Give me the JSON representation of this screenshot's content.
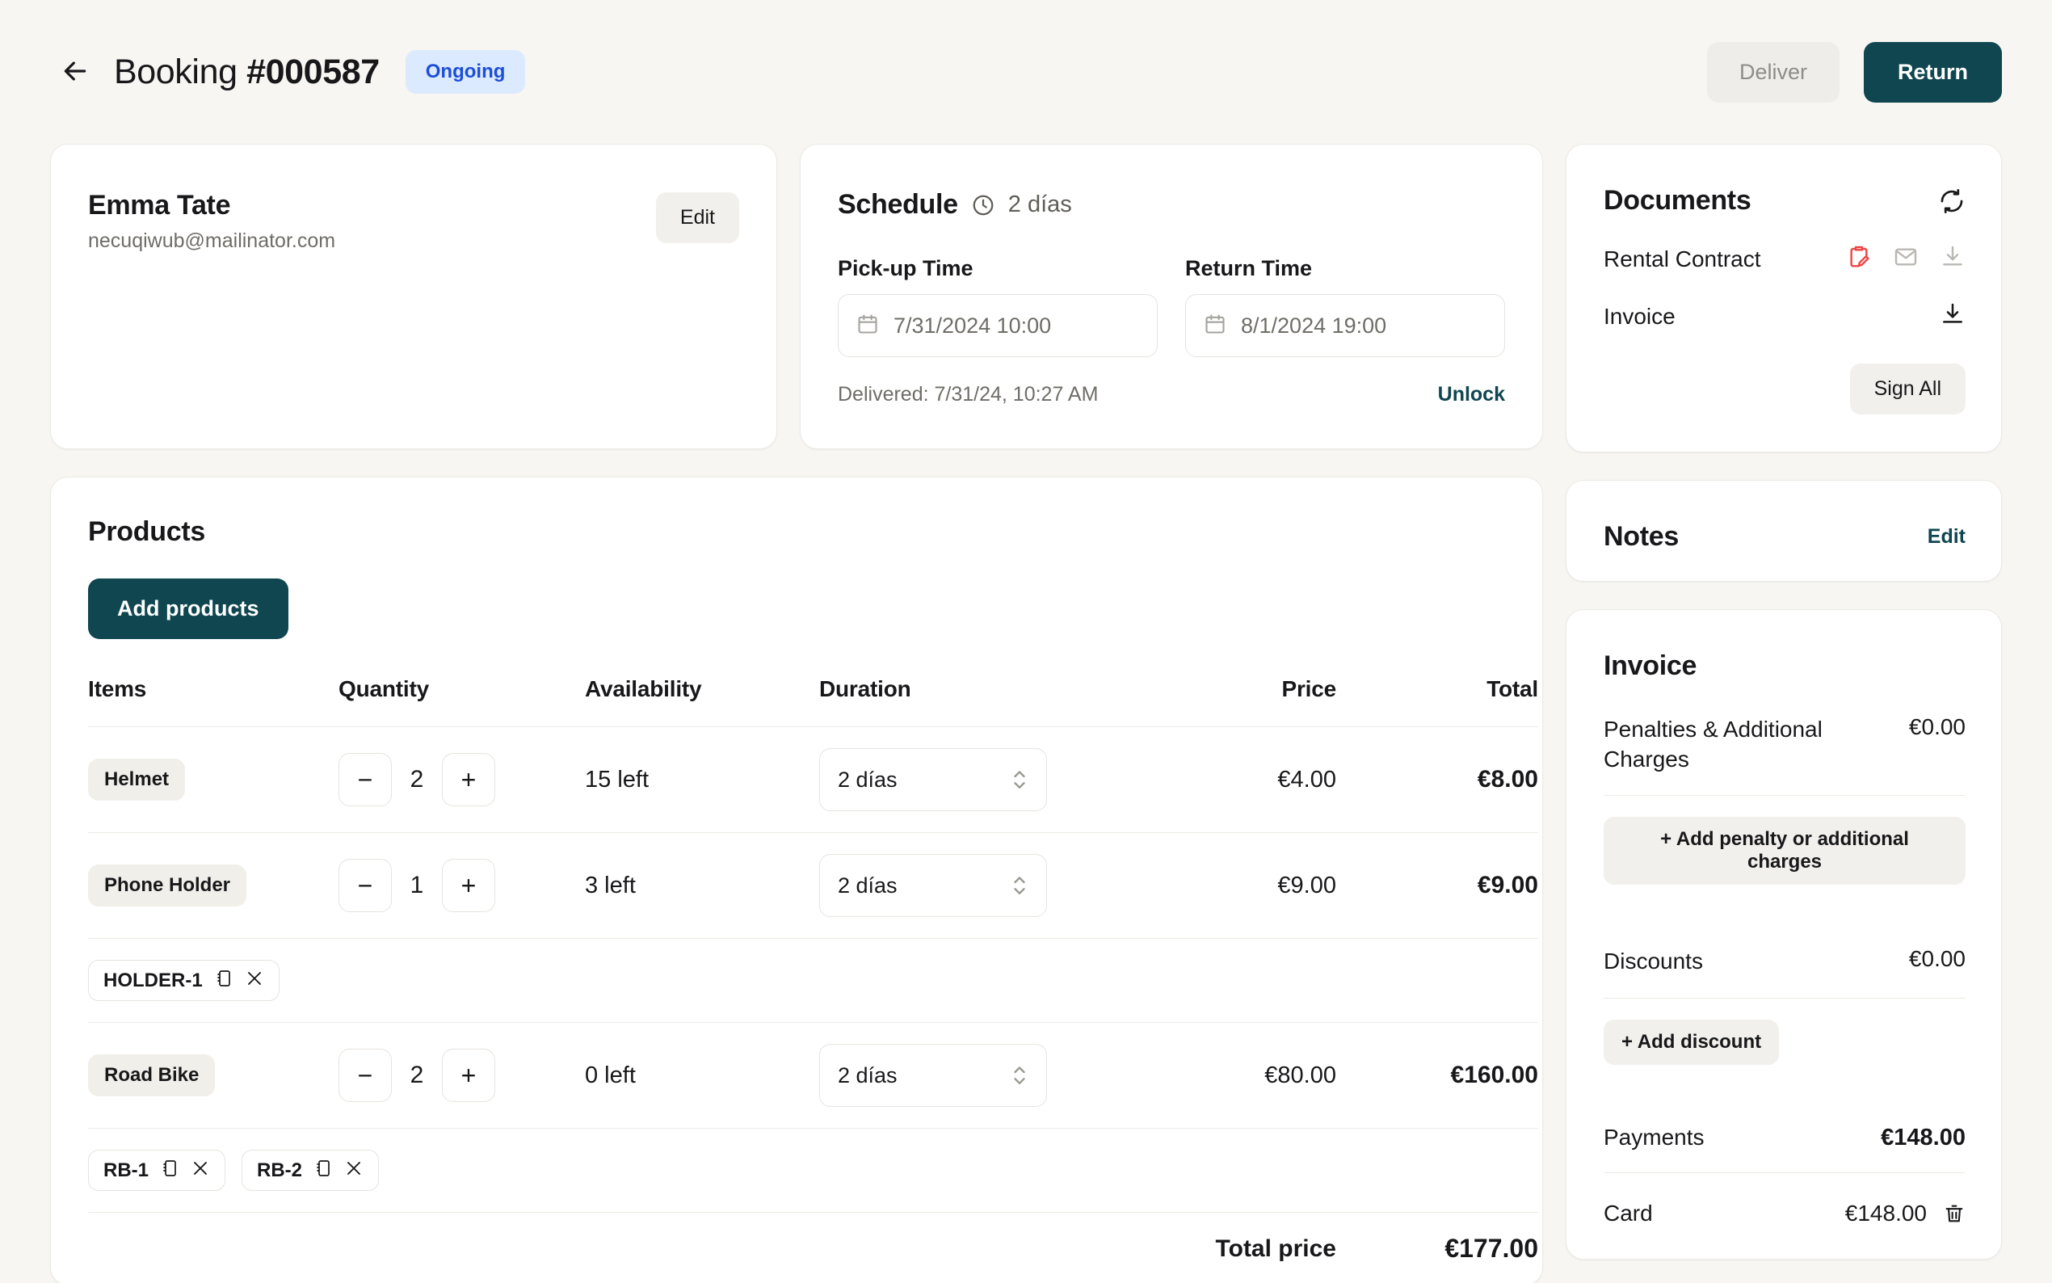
{
  "header": {
    "back_icon": "arrow-left-icon",
    "title_prefix": "Booking ",
    "title_number": "#000587",
    "status_badge": "Ongoing",
    "deliver_label": "Deliver",
    "return_label": "Return",
    "accent_teal": "#0f4650",
    "badge_bg": "#dbeafe",
    "badge_fg": "#1d4ed8"
  },
  "customer": {
    "name": "Emma Tate",
    "email": "necuqiwub@mailinator.com",
    "edit_label": "Edit"
  },
  "schedule": {
    "title": "Schedule",
    "duration": "2 días",
    "clock_icon": "clock-icon",
    "pickup_label": "Pick-up Time",
    "pickup_value": "7/31/2024 10:00",
    "return_label": "Return Time",
    "return_value": "8/1/2024 19:00",
    "delivered_text": "Delivered: 7/31/24, 10:27 AM",
    "unlock_label": "Unlock"
  },
  "documents": {
    "title": "Documents",
    "refresh_icon": "refresh-icon",
    "rows": [
      {
        "name": "Rental Contract",
        "icons": [
          "sign-contract-icon",
          "mail-icon",
          "download-icon"
        ]
      },
      {
        "name": "Invoice",
        "icons": [
          "download-icon"
        ]
      }
    ],
    "sign_all_label": "Sign All"
  },
  "notes": {
    "title": "Notes",
    "edit_label": "Edit"
  },
  "products": {
    "title": "Products",
    "add_label": "Add products",
    "columns": [
      "Items",
      "Quantity",
      "Availability",
      "Duration",
      "Price",
      "Total"
    ],
    "rows": [
      {
        "item": "Helmet",
        "qty": "2",
        "availability": "15 left",
        "duration": "2 días",
        "price": "€4.00",
        "total": "€8.00",
        "serials": []
      },
      {
        "item": "Phone Holder",
        "qty": "1",
        "availability": "3 left",
        "duration": "2 días",
        "price": "€9.00",
        "total": "€9.00",
        "serials": [
          "HOLDER-1"
        ]
      },
      {
        "item": "Road Bike",
        "qty": "2",
        "availability": "0 left",
        "duration": "2 días",
        "price": "€80.00",
        "total": "€160.00",
        "serials": [
          "RB-1",
          "RB-2"
        ]
      }
    ],
    "minus_label": "−",
    "plus_label": "+",
    "total_price_label": "Total price",
    "total_price_value": "€177.00"
  },
  "invoice": {
    "title": "Invoice",
    "penalties_label": "Penalties & Additional Charges",
    "penalties_value": "€0.00",
    "add_penalty_label": "+ Add penalty or additional charges",
    "discounts_label": "Discounts",
    "discounts_value": "€0.00",
    "add_discount_label": "+ Add discount",
    "payments_label": "Payments",
    "payments_value": "€148.00",
    "payment_rows": [
      {
        "method": "Card",
        "amount": "€148.00",
        "delete_icon": "trash-icon"
      }
    ]
  }
}
